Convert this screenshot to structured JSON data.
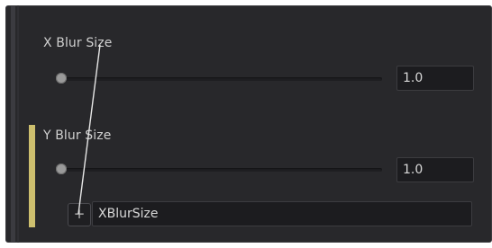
{
  "controls": {
    "x_blur": {
      "label": "X Blur Size",
      "value": "1.0"
    },
    "y_blur": {
      "label": "Y Blur Size",
      "value": "1.0",
      "expression": "XBlurSize",
      "expression_button": "+"
    }
  },
  "colors": {
    "panel_bg": "#28282b",
    "field_bg": "#1c1c1f",
    "expression_indicator": "#cdbf6e",
    "text": "#cfcfcf"
  },
  "icons": {
    "slider_knob": "circle-knob",
    "expression_link": "pick-whip-line"
  }
}
